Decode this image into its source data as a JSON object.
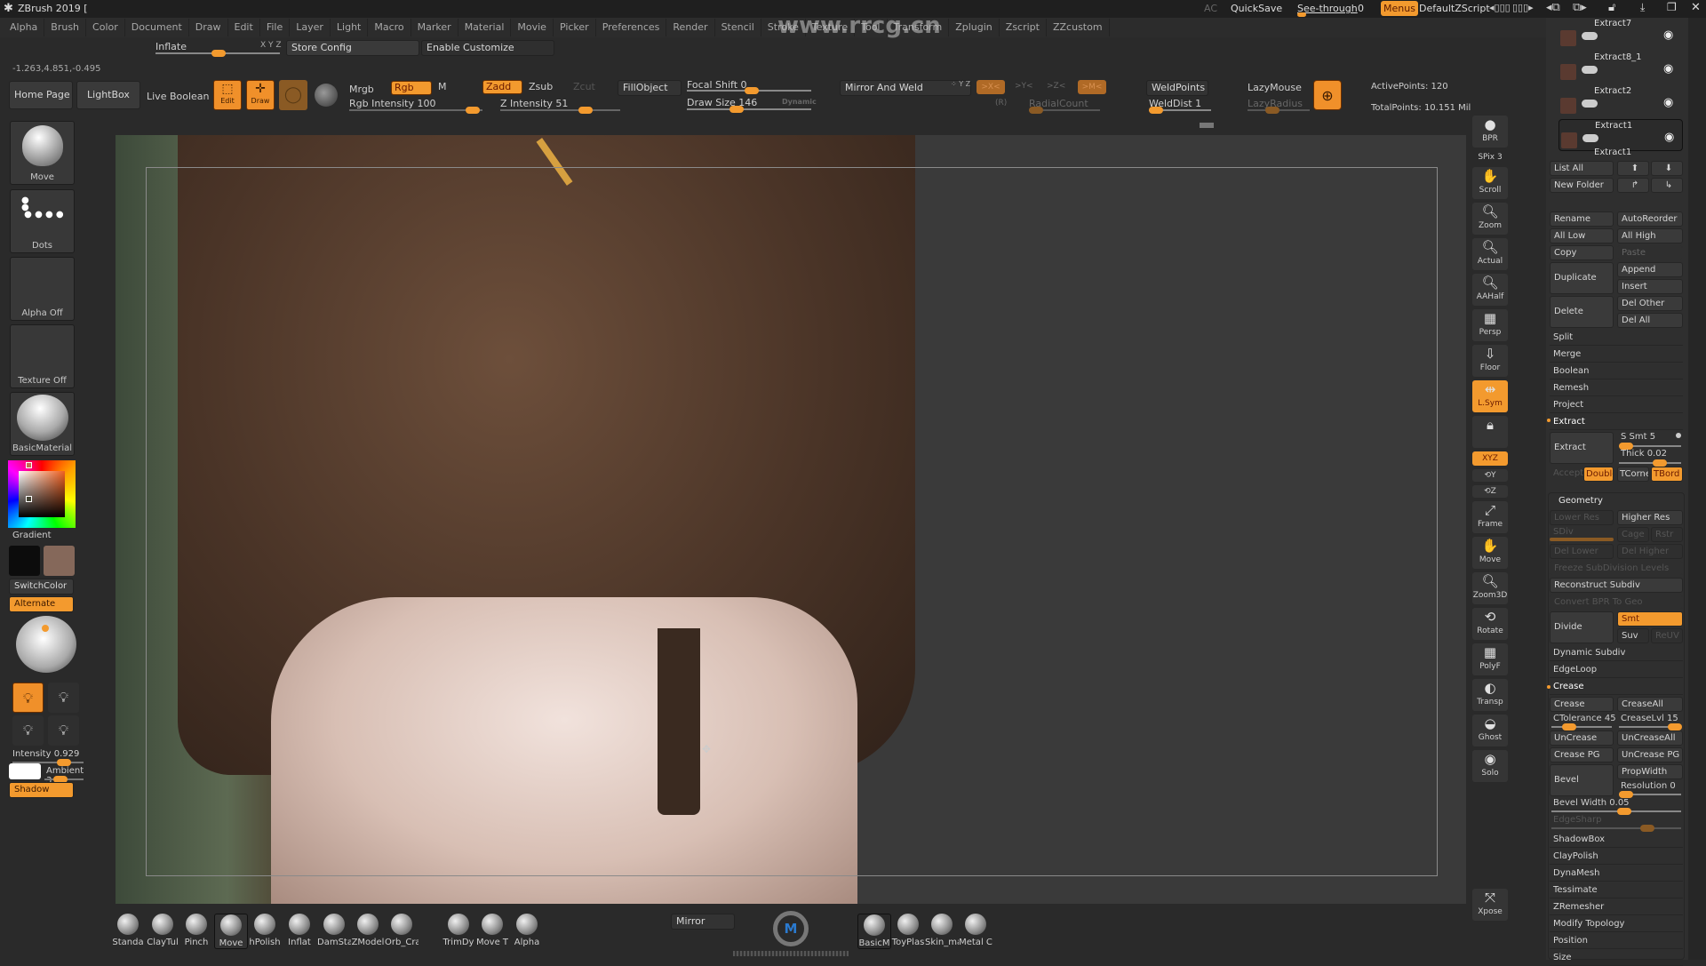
{
  "app": {
    "title": "ZBrush 2019 [",
    "watermark_url": "www.rrcg.cn",
    "top_right": {
      "ac": "AC",
      "quicksave": "QuickSave",
      "see_through_label": "See-through",
      "see_through_value": "0",
      "menus": "Menus",
      "script": "DefaultZScript"
    }
  },
  "menubar": [
    "Alpha",
    "Brush",
    "Color",
    "Document",
    "Draw",
    "Edit",
    "File",
    "Layer",
    "Light",
    "Macro",
    "Marker",
    "Material",
    "Movie",
    "Picker",
    "Preferences",
    "Render",
    "Stencil",
    "Stroke",
    "Texture",
    "Tool",
    "Transform",
    "Zplugin",
    "Zscript",
    "ZZcustom"
  ],
  "toolbar_row1": {
    "inflate_label": "Inflate",
    "xyz": "X Y Z",
    "store_config": "Store Config",
    "enable_customize": "Enable Customize"
  },
  "coords": "-1.263,4.851,-0.495",
  "toolbar": {
    "home_page": "Home Page",
    "lightbox": "LightBox",
    "live_boolean": "Live Boolean",
    "edit": "Edit",
    "draw": "Draw",
    "mrgb": "Mrgb",
    "rgb": "Rgb",
    "m": "M",
    "rgb_intensity": "Rgb Intensity 100",
    "zadd": "Zadd",
    "zsub": "Zsub",
    "zcut": "Zcut",
    "z_intensity": "Z Intensity 51",
    "fill_object": "FillObject",
    "focal_shift": "Focal Shift 0",
    "draw_size": "Draw Size 146",
    "dynamic": "Dynamic",
    "mirror_and_weld": "Mirror And Weld",
    "x_sym": ">X<",
    "y_sym": ">Y<",
    "z_sym": ">Z<",
    "m_sym": ">M<",
    "r_sym": "(R)",
    "radial_count": "RadialCount",
    "weld_points": "WeldPoints",
    "weld_dist": "WeldDist 1",
    "lazy_mouse": "LazyMouse",
    "lazy_radius": "LazyRadius",
    "active_points": "ActivePoints: 120",
    "total_points": "TotalPoints: 10.151 Mil"
  },
  "left_tray": {
    "brush": "Move",
    "stroke": "Dots",
    "alpha": "Alpha Off",
    "texture": "Texture Off",
    "material": "BasicMaterial",
    "gradient": "Gradient",
    "switch_color": "SwitchColor",
    "alternate": "Alternate",
    "intensity": "Intensity 0.929",
    "ambient": "Ambient 3",
    "shadow": "Shadow"
  },
  "right_shelf": [
    "BPR",
    "SPix 3",
    "Scroll",
    "Zoom",
    "Actual",
    "AAHalf",
    "Persp",
    "Floor",
    "L.Sym",
    "",
    "XYZ",
    "",
    "",
    "Frame",
    "Move",
    "Zoom3D",
    "Rotate",
    "PolyF",
    "Transp",
    "Ghost",
    "Solo",
    "Xpose"
  ],
  "subtools": [
    {
      "name": "Extract7"
    },
    {
      "name": "Extract8_1"
    },
    {
      "name": "Extract2"
    },
    {
      "name": "Extract1"
    }
  ],
  "selected_subtool": "Extract1",
  "subtool_buttons": {
    "list_all": "List All",
    "new_folder": "New Folder",
    "rename": "Rename",
    "auto_reorder": "AutoReorder",
    "all_low": "All Low",
    "all_high": "All High",
    "copy": "Copy",
    "paste": "Paste",
    "duplicate": "Duplicate",
    "append": "Append",
    "insert": "Insert",
    "delete": "Delete",
    "del_other": "Del Other",
    "del_all": "Del All",
    "split": "Split",
    "merge": "Merge",
    "boolean": "Boolean",
    "remesh": "Remesh",
    "project": "Project",
    "extract_section": "Extract",
    "extract": "Extract",
    "s_smt": "S Smt 5",
    "thick": "Thick 0.02",
    "accept": "Accept",
    "double": "Double",
    "tcorne": "TCorne",
    "tbord": "TBord"
  },
  "geometry": {
    "title": "Geometry",
    "lower_res": "Lower Res",
    "higher_res": "Higher Res",
    "sdiv": "SDiv",
    "cage": "Cage",
    "rstr": "Rstr",
    "del_lower": "Del Lower",
    "del_higher": "Del Higher",
    "freeze": "Freeze SubDivision Levels",
    "reconstruct": "Reconstruct Subdiv",
    "convert_bpr": "Convert BPR To Geo",
    "divide": "Divide",
    "smt": "Smt",
    "suv": "Suv",
    "reuv": "ReUV",
    "dynamic_subdiv": "Dynamic Subdiv",
    "edge_loop": "EdgeLoop",
    "crease_section": "Crease",
    "crease": "Crease",
    "crease_all": "CreaseAll",
    "ctolerance": "CTolerance 45",
    "crease_lvl": "CreaseLvl 15",
    "uncrease": "UnCrease",
    "uncrease_all": "UnCreaseAll",
    "crease_pg": "Crease PG",
    "uncrease_pg": "UnCrease PG",
    "bevel": "Bevel",
    "prop_width": "PropWidth",
    "resolution": "Resolution 0",
    "bevel_width": "Bevel Width 0.05",
    "edge_sharp": "EdgeSharp",
    "shadow_box": "ShadowBox",
    "clay_polish": "ClayPolish",
    "dynamesh": "DynaMesh",
    "tessimate": "Tessimate",
    "zremesher": "ZRemesher",
    "modify_topology": "Modify Topology",
    "position": "Position",
    "size": "Size"
  },
  "bottom_brushes": [
    "Standa",
    "ClayTul",
    "Pinch",
    "Move",
    "hPolish",
    "Inflat",
    "DamSta",
    "ZModel",
    "Orb_Cra",
    "TrimDy",
    "Move T",
    "Alpha"
  ],
  "bottom_mirror": "Mirror",
  "bottom_materials": [
    "BasicM",
    "ToyPlas",
    "Skin_ma",
    "Metal C"
  ],
  "colors": {
    "accent": "#f39a2e",
    "panel": "#2f2f2f",
    "viewport": "#3a3a3a"
  }
}
